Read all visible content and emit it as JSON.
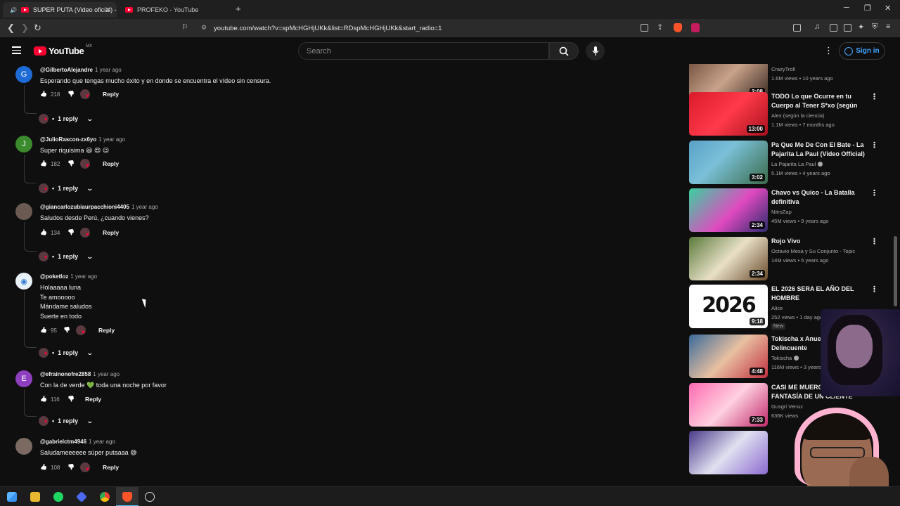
{
  "browser": {
    "tabs": [
      {
        "title": "SUPER PUTA (Video oficial) -",
        "active": true
      },
      {
        "title": "PROFEKO - YouTube",
        "active": false
      }
    ],
    "url": "youtube.com/watch?v=spMcHGHjUKk&list=RDspMcHGHjUKk&start_radio=1"
  },
  "header": {
    "logo": "YouTube",
    "region": "MX",
    "search_placeholder": "Search",
    "sign_in": "Sign in"
  },
  "colors": {
    "accent": "#ff0033",
    "link": "#3ea6ff",
    "background": "#0f0f0f"
  },
  "comments": [
    {
      "author": "@GilbertoAlejandre",
      "time": "1 year ago",
      "avatar_letter": "G",
      "avatar_color": "#1e6bd6",
      "lines": [
        "Esperando que tengas mucho éxito y en donde se encuentra el vídeo sin censura."
      ],
      "likes": "218",
      "reply": "Reply",
      "replies": "1 reply"
    },
    {
      "author": "@JulioRascon-zx6yo",
      "time": "1 year ago",
      "avatar_letter": "J",
      "avatar_color": "#3c8a2e",
      "lines": [
        "Super riquisima 😃 😍 😉"
      ],
      "likes": "182",
      "reply": "Reply",
      "replies": "1 reply"
    },
    {
      "author": "@giancarlozubiaurpacchioni4405",
      "time": "1 year ago",
      "avatar_letter": "",
      "avatar_color": "#6b5a52",
      "lines": [
        "Saludos desde Perú, ¿cuando vienes?"
      ],
      "likes": "134",
      "reply": "Reply",
      "replies": "1 reply"
    },
    {
      "author": "@poketloz",
      "time": "1 year ago",
      "avatar_letter": "",
      "avatar_color": "#e8f0f8",
      "lines": [
        "Holaaaaa luna",
        "Te amooooo",
        "Mándame saludos",
        "Suerte en todo"
      ],
      "likes": "95",
      "reply": "Reply",
      "replies": "1 reply"
    },
    {
      "author": "@efrainonofre2858",
      "time": "1 year ago",
      "avatar_letter": "E",
      "avatar_color": "#8e3fbf",
      "lines": [
        "Con la de verde 💚 toda una noche por favor"
      ],
      "likes": "116",
      "reply": "Reply",
      "replies": "1 reply"
    },
    {
      "author": "@gabrielctm4946",
      "time": "1 year ago",
      "avatar_letter": "",
      "avatar_color": "#7a6a62",
      "lines": [
        "Saludameeeeee súper putaaaa 😅"
      ],
      "likes": "108",
      "reply": "Reply",
      "replies": ""
    }
  ],
  "sidebar": [
    {
      "title": "",
      "channel": "CrazyTroll",
      "stats": "1.6M views • 10 years ago",
      "duration": "2:08",
      "thumb": "linear-gradient(135deg,#6b4a3a,#c9a28a 50%,#3a2a22)"
    },
    {
      "title": "TODO Lo que Ocurre en tu Cuerpo al Tener S*xo (según l...",
      "channel": "Alex (según la ciencia)",
      "stats": "1.1M views • 7 months ago",
      "duration": "13:00",
      "thumb": "linear-gradient(135deg,#d91a2a,#ff3a4a 50%,#a8101c)"
    },
    {
      "title": "Pa Que Me De Con El Bate - La Pajarita La Paul (Video Official)",
      "channel": "La Pajarita La Paul",
      "stats": "5.1M views • 4 years ago",
      "duration": "3:02",
      "thumb": "linear-gradient(135deg,#5aa0c8,#7ac0d8 40%,#3a6a4a)"
    },
    {
      "title": "Chavo vs Quico - La Batalla definitiva",
      "channel": "NitroZap",
      "stats": "45M views • 9 years ago",
      "duration": "2:34",
      "thumb": "linear-gradient(135deg,#3ad0a0,#e04ac0 55%,#2a2a6a)"
    },
    {
      "title": "Rojo Vivo",
      "channel": "Octavio Mesa y Su Conjunto - Topic",
      "stats": "14M views • 5 years ago",
      "duration": "2:34",
      "thumb": "linear-gradient(135deg,#5a7a3a,#e8e0c8 50%,#6a4a2a)"
    },
    {
      "title": "EL 2026 SERA EL AÑO DEL HOMBRE",
      "channel": "Alice",
      "stats": "252 views • 1 day ago",
      "duration": "9:18",
      "badge": "New",
      "thumb": "#ffffff"
    },
    {
      "title": "Tokischa x Anuel AA - Flow - Delincuente",
      "channel": "Tokischa",
      "stats": "116M views • 3 years ago",
      "duration": "4:48",
      "thumb": "linear-gradient(135deg,#3a6a9a,#e8c0a0 50%,#c03040)"
    },
    {
      "title": "CASI ME MUERO EN LA FANTASÍA DE UN CLIENTE",
      "channel": "Gusgri Venuz",
      "stats": "636K views",
      "duration": "7:33",
      "thumb": "linear-gradient(135deg,#ff6ab0,#ffd0e0 50%,#c02a6a)"
    },
    {
      "title": "",
      "channel": "",
      "stats": "",
      "duration": "",
      "thumb": "linear-gradient(135deg,#4a3a8a,#e0e0f0 50%,#8a6ad0)"
    }
  ]
}
